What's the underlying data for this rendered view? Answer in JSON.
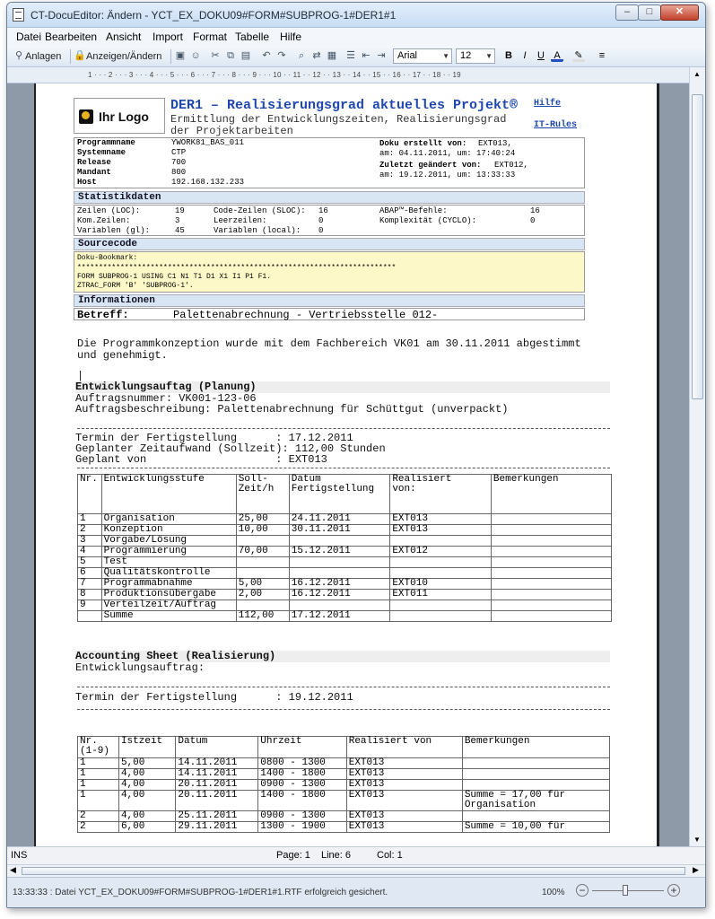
{
  "window": {
    "title": "CT-DocuEditor: Ändern - YCT_EX_DOKU09#FORM#SUBPROG-1#DER1#1"
  },
  "menu": [
    "Datei",
    "Bearbeiten",
    "Ansicht",
    "Import",
    "Format",
    "Tabelle",
    "Hilfe"
  ],
  "toolbar": {
    "attach_label": "Anlagen",
    "view_edit_label": "Anzeigen/Ändern",
    "font": "Arial",
    "size": "12"
  },
  "ruler": "1 · · · 2 · · · 3 · · · 4 · · · 5 · · · 6 · · · 7 · · · 8 · · · 9 · · · 10 · · 11 · · 12 · · 13 · · 14 · · 15 · · 16 · · 17 · · 18 · · 19",
  "doc": {
    "logo_text": "Ihr Logo",
    "title": "DER1 – Realisierungsgrad aktuelles Projekt®",
    "subtitle": "Ermittlung der Entwicklungszeiten, Realisierungsgrad der Projektarbeiten",
    "help": "Hilfe",
    "itrules": "IT-Rules",
    "meta": [
      {
        "k": "Programmname",
        "v": "YWORK81_BAS_011"
      },
      {
        "k": "Systemname",
        "v": "CTP"
      },
      {
        "k": "Release",
        "v": "700"
      },
      {
        "k": "Mandant",
        "v": "800"
      },
      {
        "k": "Host",
        "v": "192.168.132.233"
      }
    ],
    "doku_created_label": "Doku erstellt von:",
    "doku_created_by": "EXT013,",
    "doku_created_at": "am: 04.11.2011, um: 17:40:24",
    "changed_label": "Zuletzt geändert von:",
    "changed_by": "EXT012,",
    "changed_at": "am: 19.12.2011, um: 13:33:33",
    "stats_title": "Statistikdaten",
    "stats": [
      [
        "Zeilen (LOC):",
        "19",
        "Code-Zeilen (SLOC):",
        "16",
        "ABAP™-Befehle:",
        "16"
      ],
      [
        "Kom.Zeilen:",
        "3",
        "Leerzeilen:",
        "0",
        "Komplexität (CYCLO):",
        "0"
      ],
      [
        "Variablen (gl):",
        "45",
        "Variablen (local):",
        "0",
        "",
        ""
      ]
    ],
    "source_title": "Sourcecode",
    "source_lines": [
      "Doku-Bookmark:",
      "**************************************************************************",
      "FORM SUBPROG-1 USING C1 N1 T1 D1 X1 I1 P1 F1.",
      "ZTRAC_FORM 'B' 'SUBPROG-1'."
    ],
    "info_title": "Informationen",
    "betreff_label": "Betreff:",
    "betreff_value": "Palettenabrechnung - Vertriebsstelle 012-",
    "intro": "Die Programmkonzeption wurde mit dem Fachbereich VK01 am 30.11.2011 abgestimmt",
    "intro2": "und genehmigt.",
    "dev_title": "Entwicklungsauftag (Planung)",
    "order_no": "Auftragsnummer: VK001-123-06",
    "order_desc": "Auftragsbeschreibung: Palettenabrechnung für Schüttgut (unverpackt)",
    "plan1": "Termin der Fertigstellung      : 17.12.2011",
    "plan2": "Geplanter Zeitaufwand (Sollzeit): 112,00 Stunden",
    "plan3": "Geplant von                    : EXT013",
    "stage_headers": [
      "Nr.",
      "Entwicklungsstufe",
      "Soll-\nZeit/h",
      "Datum\nFertigstellung",
      "Realisiert\nvon:",
      "Bemerkungen"
    ],
    "stages": [
      [
        "1",
        "Organisation",
        "25,00",
        "24.11.2011",
        "EXT013",
        ""
      ],
      [
        "2",
        "Konzeption",
        "10,00",
        "30.11.2011",
        "EXT013",
        ""
      ],
      [
        "3",
        "Vorgabe/Lösung",
        "",
        "",
        "",
        ""
      ],
      [
        "4",
        "Programmierung",
        "70,00",
        "15.12.2011",
        "EXT012",
        ""
      ],
      [
        "5",
        "Test",
        "",
        "",
        "",
        ""
      ],
      [
        "6",
        "Qualitätskontrolle",
        "",
        "",
        "",
        ""
      ],
      [
        "7",
        "Programmabnahme",
        "5,00",
        "16.12.2011",
        "EXT010",
        ""
      ],
      [
        "8",
        "Produktionsübergabe",
        "2,00",
        "16.12.2011",
        "EXT011",
        ""
      ],
      [
        "9",
        "Verteilzeit/Auftrag",
        "",
        "",
        "",
        ""
      ],
      [
        "",
        "Summe",
        "112,00",
        "17.12.2011",
        "",
        ""
      ]
    ],
    "acc_title": "Accounting Sheet (Realisierung)",
    "acc_sub": "Entwicklungsauftrag:",
    "acc_done": "Termin der Fertigstellung      : 19.12.2011",
    "acc_headers": [
      "Nr.\n(1-9)",
      "Istzeit",
      "Datum",
      "Uhrzeit",
      "Realisiert von",
      "Bemerkungen"
    ],
    "acc_rows": [
      [
        "1",
        "5,00",
        "14.11.2011",
        "0800 - 1300",
        "EXT013",
        ""
      ],
      [
        "1",
        "4,00",
        "14.11.2011",
        "1400 - 1800",
        "EXT013",
        ""
      ],
      [
        "1",
        "4,00",
        "20.11.2011",
        "0900 - 1300",
        "EXT013",
        ""
      ],
      [
        "1",
        "4,00",
        "20.11.2011",
        "1400 - 1800",
        "EXT013",
        "Summe = 17,00 für\nOrganisation"
      ],
      [
        "2",
        "4,00",
        "25.11.2011",
        "0900 - 1300",
        "EXT013",
        ""
      ],
      [
        "2",
        "6,00",
        "29.11.2011",
        "1300 - 1900",
        "EXT013",
        "Summe = 10,00 für"
      ]
    ]
  },
  "status": {
    "mode": "INS",
    "page": "Page: 1",
    "line": "Line: 6",
    "col": "Col: 1"
  },
  "info": {
    "message": "13:33:33 : Datei YCT_EX_DOKU09#FORM#SUBPROG-1#DER1#1.RTF erfolgreich gesichert.",
    "zoom": "100%"
  }
}
